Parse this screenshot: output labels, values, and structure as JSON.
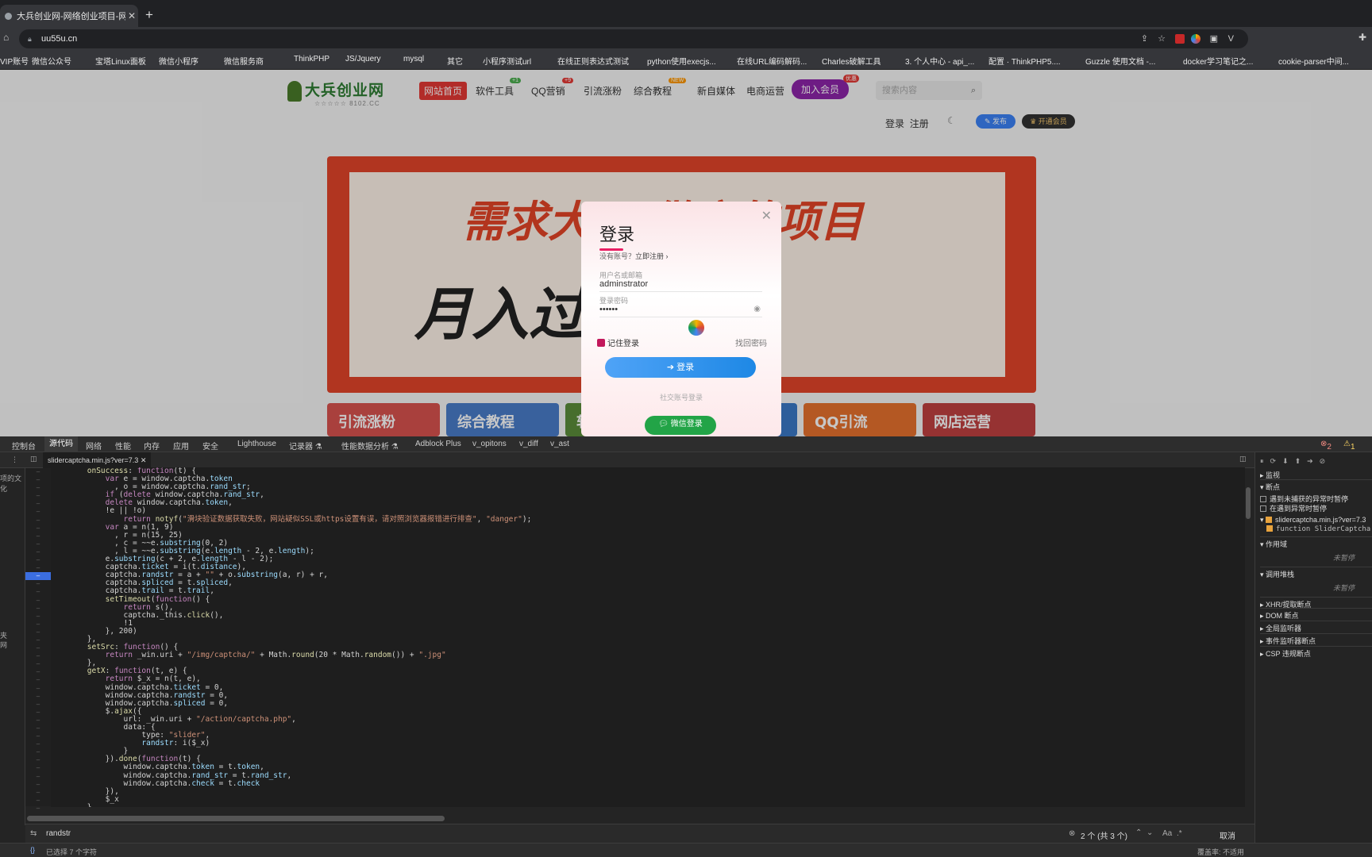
{
  "browser": {
    "tab_title": "大兵创业网-网络创业项目-网络副",
    "url": "uu55u.cn",
    "bookmarks": [
      "VIP账号",
      "微信公众号",
      "宝塔Linux面板",
      "微信小程序",
      "微信服务商",
      "ThinkPHP",
      "JS/Jquery",
      "mysql",
      "其它",
      "小程序测试url",
      "在线正则表达式测试",
      "python使用execjs...",
      "在线URL编码解码...",
      "Charles破解工具",
      "3. 个人中心 - api_...",
      "配置 · ThinkPHP5....",
      "Guzzle 使用文档 -...",
      "docker学习笔记之...",
      "cookie-parser中间..."
    ]
  },
  "site": {
    "logo": "大兵创业网",
    "logo_sub": "☆☆☆☆☆ 8102.CC",
    "nav": [
      "网站首页",
      "软件工具",
      "QQ营销",
      "引流涨粉",
      "综合教程",
      "新自媒体",
      "电商运营",
      "加入会员"
    ],
    "badges": {
      "tools": "+1",
      "qq": "+9",
      "tutorial": "NEW",
      "vip": "优惠"
    },
    "search_placeholder": "搜索内容",
    "login": "登录",
    "register": "注册",
    "publish": "✎ 发布",
    "open_vip": "♛ 开通会员",
    "banner_line1": "需求大 易做实的项目",
    "banner_line2": "月入过 简单单",
    "tiles": [
      "引流涨粉",
      "综合教程",
      "软",
      "QQ引流",
      "网店运营"
    ]
  },
  "modal": {
    "title": "登录",
    "no_account": "没有账号？",
    "register_now": "立即注册 ›",
    "username_label": "用户名或邮箱",
    "username_value": "adminstrator",
    "password_label": "登录密码",
    "password_value": "••••••",
    "remember": "记住登录",
    "forgot": "找回密码",
    "submit": "登录",
    "social": "社交账号登录",
    "wechat": "微信登录"
  },
  "devtools": {
    "tabs": [
      "控制台",
      "源代码",
      "网络",
      "性能",
      "内存",
      "应用",
      "安全",
      "Lighthouse",
      "记录器 ⚗",
      "性能数据分析 ⚗",
      "Adblock Plus",
      "v_opitons",
      "v_diff",
      "v_ast"
    ],
    "active_tab": "源代码",
    "errors": "2",
    "warnings": "1",
    "file_tab": "slidercaptcha.min.js?ver=7.3",
    "search_query": "randstr",
    "match_count": "2 个 (共 3 个)",
    "match_case": "Aa",
    "regex": ".*",
    "cancel": "取消",
    "status_left": "已选择 7 个字符",
    "status_right": "覆盖率: 不适用",
    "left_pane": [
      "项的文化",
      "夹",
      "网"
    ],
    "side_panel": {
      "watch": "监视",
      "breakpoints": "断点",
      "pause_uncaught": "遇到未捕获的异常时暂停",
      "pause_caught": "在遇到异常时暂停",
      "bp_file": "slidercaptcha.min.js?ver=7.3",
      "bp_code": "function SliderCaptcha",
      "scope": "作用域",
      "not_paused": "未暂停",
      "call_stack": "调用堆栈",
      "xhr": "XHR/提取断点",
      "dom": "DOM 断点",
      "global": "全局监听器",
      "event": "事件监听器断点",
      "csp": "CSP 违规断点"
    },
    "code_lines": [
      "        onSuccess: function(t) {",
      "            var e = window.captcha.token",
      "              , o = window.captcha.rand_str;",
      "            if (delete window.captcha.rand_str,",
      "            delete window.captcha.token,",
      "            !e || !o)",
      "                return notyf(\"滑块验证数据获取失败，网站疑似SSL或https设置有误，请对照浏览器报错进行排查\", \"danger\");",
      "            var a = n(1, 9)",
      "              , r = n(15, 25)",
      "              , c = ~~e.substring(0, 2)",
      "              , l = ~~e.substring(e.length - 2, e.length);",
      "            e.substring(c + 2, e.length - l - 2);",
      "            captcha.ticket = i(t.distance),",
      "            captcha.randstr = a + \"\" + o.substring(a, r) + r,",
      "            captcha.spliced = t.spliced,",
      "            captcha.trail = t.trail,",
      "            setTimeout(function() {",
      "                return s(),",
      "                captcha._this.click(),",
      "                !1",
      "            }, 200)",
      "        },",
      "        setSrc: function() {",
      "            return _win.uri + \"/img/captcha/\" + Math.round(20 * Math.random()) + \".jpg\"",
      "        },",
      "        getX: function(t, e) {",
      "            return $_x = n(t, e),",
      "            window.captcha.ticket = 0,",
      "            window.captcha.randstr = 0,",
      "            window.captcha.spliced = 0,",
      "            $.ajax({",
      "                url: _win.uri + \"/action/captcha.php\",",
      "                data: {",
      "                    type: \"slider\",",
      "                    randstr: i($_x)",
      "                }",
      "            }).done(function(t) {",
      "                window.captcha.token = t.token,",
      "                window.captcha.rand_str = t.rand_str,",
      "                window.captcha.check = t.check",
      "            }),",
      "            $_x",
      "        }"
    ]
  }
}
